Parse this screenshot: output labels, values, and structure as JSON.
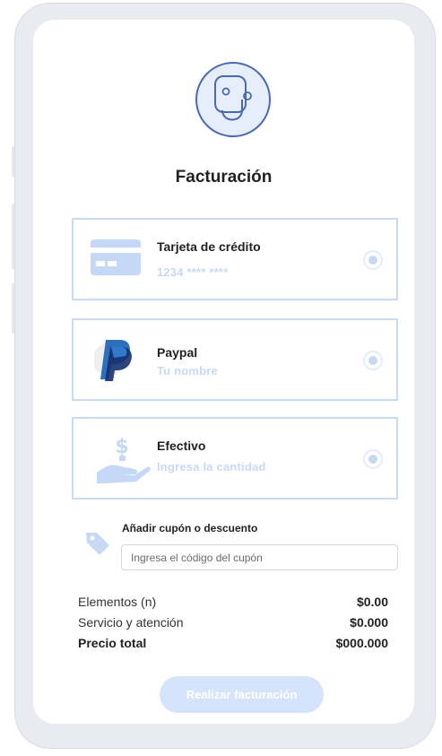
{
  "header": {
    "title": "Facturación"
  },
  "payment_methods": [
    {
      "label": "Tarjeta de crédito",
      "detail": "1234 **** ****",
      "icon": "credit-card-icon"
    },
    {
      "label": "Paypal",
      "detail": "Tu nombre",
      "icon": "paypal-logo"
    },
    {
      "label": "Efectivo",
      "detail": "Ingresa la cantidad",
      "icon": "cash-hand-icon"
    }
  ],
  "coupon": {
    "label": "Añadir cupón o descuento",
    "placeholder": "Ingresa el código del cupón",
    "value": "",
    "icon": "tag-icon"
  },
  "summary": {
    "items_label": "Elementos (n)",
    "items_value": "$0.00",
    "service_label": "Servicio y atención",
    "service_value": "$0.000",
    "total_label": "Precio total",
    "total_value": "$000.000"
  },
  "submit": {
    "label": "Realizar facturación"
  },
  "colors": {
    "accent": "#4a6ab0",
    "light_accent": "#c9d9f4",
    "card_border": "#cbdaf3",
    "button_bg": "#d5e4fb"
  }
}
